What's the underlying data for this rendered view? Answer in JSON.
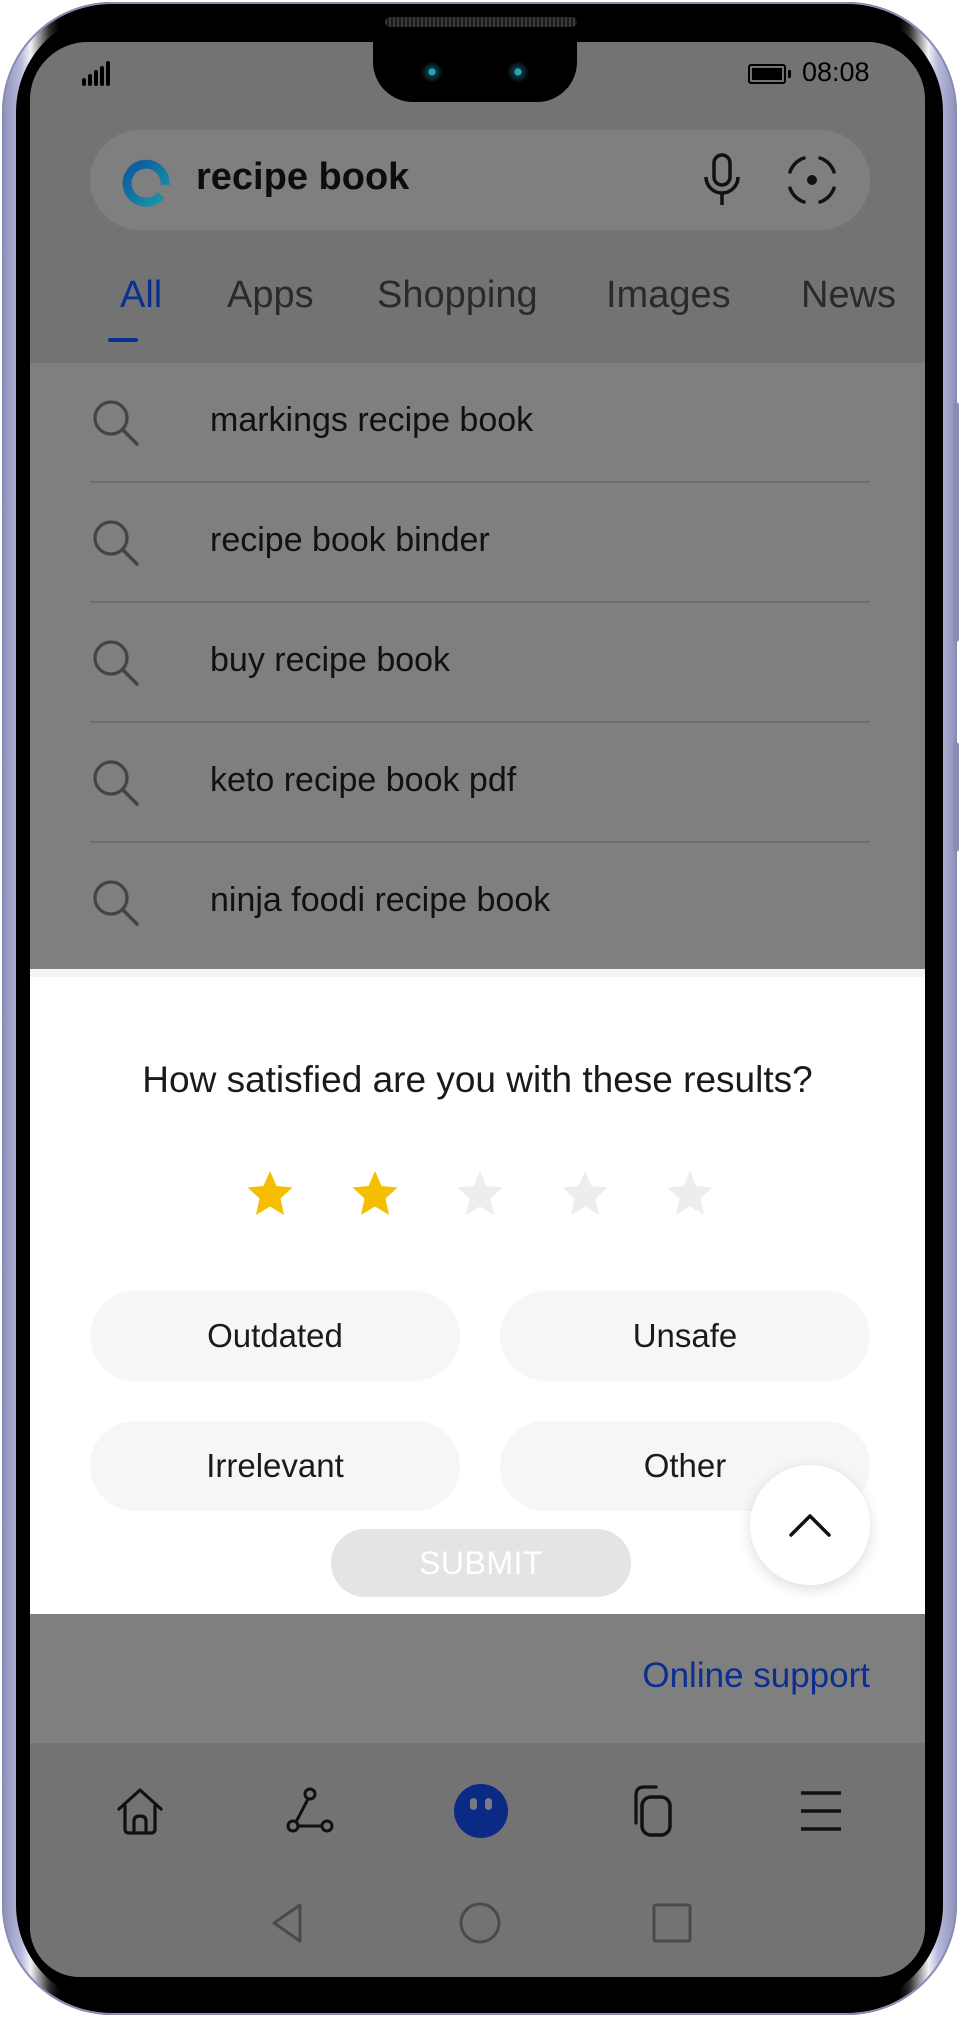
{
  "status_bar": {
    "time": "08:08",
    "signal_icon": "signal-icon",
    "battery_icon": "battery-icon"
  },
  "search": {
    "logo_icon": "search-app-logo-icon",
    "query": "recipe book",
    "mic_icon": "microphone-icon",
    "scan_icon": "visual-search-icon"
  },
  "tabs": [
    {
      "label": "All",
      "active": true
    },
    {
      "label": "Apps",
      "active": false
    },
    {
      "label": "Shopping",
      "active": false
    },
    {
      "label": "Images",
      "active": false
    },
    {
      "label": "News",
      "active": false
    }
  ],
  "suggestions": [
    {
      "icon": "search-icon",
      "text": "markings recipe book"
    },
    {
      "icon": "search-icon",
      "text": "recipe book binder"
    },
    {
      "icon": "search-icon",
      "text": "buy recipe book"
    },
    {
      "icon": "search-icon",
      "text": "keto recipe book pdf"
    },
    {
      "icon": "search-icon",
      "text": "ninja foodi recipe book"
    }
  ],
  "feedback": {
    "question": "How satisfied are you with these results?",
    "rating": 2,
    "rating_max": 5,
    "star_filled_color": "#F5BE00",
    "star_empty_color": "#EDEDED",
    "reasons": [
      "Outdated",
      "Unsafe",
      "Irrelevant",
      "Other"
    ],
    "submit_label": "SUBMIT",
    "submit_enabled": false,
    "scroll_top_icon": "chevron-up-icon"
  },
  "footer": {
    "online_support": "Online support",
    "link_color": "#0B2F8F"
  },
  "bottom_nav": [
    {
      "icon": "home-icon",
      "label": "Home"
    },
    {
      "icon": "discover-icon",
      "label": "Discover"
    },
    {
      "icon": "assistant-icon",
      "label": "Assistant"
    },
    {
      "icon": "tabs-icon",
      "label": "Tabs"
    },
    {
      "icon": "menu-icon",
      "label": "Menu"
    }
  ],
  "system_nav": [
    {
      "icon": "back-icon"
    },
    {
      "icon": "home-circle-icon"
    },
    {
      "icon": "recents-icon"
    }
  ]
}
